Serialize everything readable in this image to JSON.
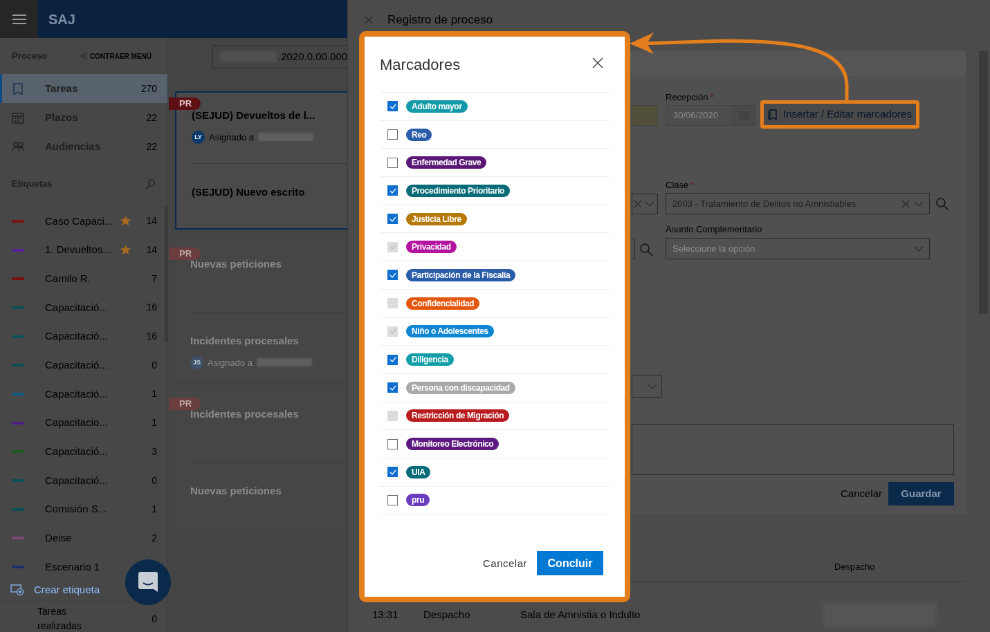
{
  "app": {
    "logo": "SAJ"
  },
  "sidebar": {
    "section_title": "Proceso",
    "collapse_label": "CONTRAER MENÚ",
    "nav": [
      {
        "kind": "book",
        "label": "Tareas",
        "count": "270",
        "selected": true
      },
      {
        "kind": "calendar",
        "label": "Plazos",
        "count": "22",
        "selected": false
      },
      {
        "kind": "people",
        "label": "Audiencias",
        "count": "22",
        "selected": false
      }
    ],
    "tags_title": "Etiquetas",
    "tags": [
      {
        "label": "Caso Capaci...",
        "count": "14",
        "color": "#7a1212",
        "starred": true
      },
      {
        "label": "1. Devueltos...",
        "count": "14",
        "color": "#5a1f9a",
        "starred": true
      },
      {
        "label": "Camilo R.",
        "count": "7",
        "color": "#7a1212",
        "starred": false
      },
      {
        "label": "Capacitació...",
        "count": "16",
        "color": "#0c4f55",
        "starred": false
      },
      {
        "label": "Capacitació...",
        "count": "16",
        "color": "#0c4f55",
        "starred": false
      },
      {
        "label": "Capacitació...",
        "count": "0",
        "color": "#0c4f55",
        "starred": false
      },
      {
        "label": "Capacitació...",
        "count": "1",
        "color": "#155a86",
        "starred": false
      },
      {
        "label": "Capacitacio...",
        "count": "1",
        "color": "#4e1f8a",
        "starred": false
      },
      {
        "label": "Capacitació...",
        "count": "3",
        "color": "#1f5a22",
        "starred": false
      },
      {
        "label": "Capacitació...",
        "count": "0",
        "color": "#0c4f55",
        "starred": false
      },
      {
        "label": "Comisión S...",
        "count": "1",
        "color": "#0c4f55",
        "starred": false
      },
      {
        "label": "Deise",
        "count": "2",
        "color": "#7a4a70",
        "starred": false
      },
      {
        "label": "Escenario 1",
        "color": "#1b2f6a",
        "starred": false
      }
    ],
    "create_tag": "Crear etiqueta",
    "done": {
      "label": "Tareas realizadas",
      "count": "0"
    }
  },
  "search": {
    "value": ".2020.0.00.000"
  },
  "cards": [
    {
      "flag": "PR",
      "selected": true,
      "faded": false,
      "tasks": [
        {
          "title": "(SEJUD) Devueltos de l...",
          "assignee_initials": "LY",
          "assigned_label": "Asignado a"
        },
        {
          "title": "(SEJUD) Nuevo escrito"
        }
      ]
    },
    {
      "flag": "PR",
      "selected": false,
      "faded": true,
      "tasks": [
        {
          "title": "Nuevas peticiones"
        },
        {
          "title": "Incidentes procesales",
          "assignee_initials": "JS",
          "assigned_label": "Asignado a"
        }
      ]
    },
    {
      "flag": "PR",
      "selected": false,
      "faded": true,
      "tasks": [
        {
          "title": "Incidentes procesales"
        },
        {
          "title": "Nuevas peticiones"
        }
      ]
    }
  ],
  "drawer": {
    "title": "Registro de proceso",
    "reception": {
      "label": "Recepción",
      "required_mark": "*",
      "value": "30/06/2020"
    },
    "markers_button": "Insertar / Editar marcadores",
    "clase": {
      "label": "Clase",
      "required_mark": "*",
      "value": "2003 - Tratamiento de Delitos no Amnistiables"
    },
    "asunto": {
      "label": "Asunto Complementario",
      "placeholder": "Seleccione la opción"
    },
    "cancel": "Cancelar",
    "save": "Guardar",
    "table": {
      "columns": [
        "Despacho"
      ],
      "rows": [
        [
          "13:31",
          "Despacho",
          "Sala de Amnistia o Indulto"
        ]
      ]
    }
  },
  "modal": {
    "title": "Marcadores",
    "markers": [
      {
        "label": "Adulto mayor",
        "color": "#139aa8",
        "checked": true,
        "disabled": false
      },
      {
        "label": "Reo",
        "color": "#2a5ca8",
        "checked": false,
        "disabled": false
      },
      {
        "label": "Enfermedad Grave",
        "color": "#5a1775",
        "checked": false,
        "disabled": false
      },
      {
        "label": "Procedimiento Prioritario",
        "color": "#086c78",
        "checked": true,
        "disabled": false
      },
      {
        "label": "Justicia Libre",
        "color": "#b57908",
        "checked": true,
        "disabled": false
      },
      {
        "label": "Privacidad",
        "color": "#b3139e",
        "checked": true,
        "disabled": true
      },
      {
        "label": "Participación de la Fiscalía",
        "color": "#2a5ca8",
        "checked": true,
        "disabled": false
      },
      {
        "label": "Confidencialidad",
        "color": "#e4560c",
        "checked": false,
        "disabled": true
      },
      {
        "label": "Niño o Adolescentes",
        "color": "#0f86d3",
        "checked": true,
        "disabled": true
      },
      {
        "label": "Diligencia",
        "color": "#149fa8",
        "checked": true,
        "disabled": false
      },
      {
        "label": "Persona con discapacidad",
        "color": "#a9a9a9",
        "checked": true,
        "disabled": false
      },
      {
        "label": "Restricción de Migración",
        "color": "#b81c1f",
        "checked": false,
        "disabled": true
      },
      {
        "label": "Monitoreo Electrónico",
        "color": "#5c1a80",
        "checked": false,
        "disabled": false
      },
      {
        "label": "UIA",
        "color": "#086c78",
        "checked": true,
        "disabled": false
      },
      {
        "label": "pru",
        "color": "#6a3dbf",
        "checked": false,
        "disabled": false
      }
    ],
    "cancel": "Cancelar",
    "confirm": "Concluir"
  }
}
